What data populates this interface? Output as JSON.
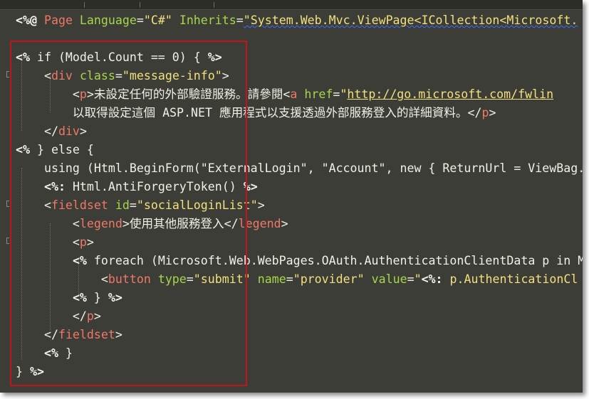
{
  "editor": {
    "lines": [
      {
        "segments": [
          {
            "t": "<%@ ",
            "c": "delim"
          },
          {
            "t": "Page ",
            "c": "tag"
          },
          {
            "t": "Language",
            "c": "attr"
          },
          {
            "t": "=",
            "c": "plain"
          },
          {
            "t": "\"C#\"",
            "c": "str"
          },
          {
            "t": " ",
            "c": "plain"
          },
          {
            "t": "Inherits",
            "c": "attr"
          },
          {
            "t": "=",
            "c": "plain"
          },
          {
            "t": "\"System.Web.Mvc.ViewPage<ICollection<Microsoft.",
            "c": "str squiggle"
          }
        ]
      },
      {
        "segments": []
      },
      {
        "segments": [
          {
            "t": "<%",
            "c": "delim"
          },
          {
            "t": " if (Model.Count == 0) { ",
            "c": "plain"
          },
          {
            "t": "%>",
            "c": "delim"
          }
        ]
      },
      {
        "segments": [
          {
            "t": "    <",
            "c": "plain"
          },
          {
            "t": "div",
            "c": "tag"
          },
          {
            "t": " ",
            "c": "plain"
          },
          {
            "t": "class",
            "c": "attr"
          },
          {
            "t": "=",
            "c": "plain"
          },
          {
            "t": "\"message-info\"",
            "c": "str"
          },
          {
            "t": ">",
            "c": "plain"
          }
        ]
      },
      {
        "segments": [
          {
            "t": "        <",
            "c": "plain"
          },
          {
            "t": "p",
            "c": "tag"
          },
          {
            "t": ">未設定任何的外部驗證服務。請參閱<",
            "c": "plain"
          },
          {
            "t": "a",
            "c": "tag"
          },
          {
            "t": " ",
            "c": "plain"
          },
          {
            "t": "href",
            "c": "attr"
          },
          {
            "t": "=",
            "c": "plain"
          },
          {
            "t": "\"",
            "c": "str"
          },
          {
            "t": "http://go.microsoft.com/fwlin",
            "c": "url"
          }
        ]
      },
      {
        "segments": [
          {
            "t": "        以取得設定這個 ASP.NET 應用程式以支援透過外部服務登入的詳細資料。</",
            "c": "plain"
          },
          {
            "t": "p",
            "c": "tag"
          },
          {
            "t": ">",
            "c": "plain"
          }
        ]
      },
      {
        "segments": [
          {
            "t": "    </",
            "c": "plain"
          },
          {
            "t": "div",
            "c": "tag"
          },
          {
            "t": ">",
            "c": "plain"
          }
        ]
      },
      {
        "segments": [
          {
            "t": "<%",
            "c": "delim"
          },
          {
            "t": " } else {",
            "c": "plain"
          }
        ]
      },
      {
        "segments": [
          {
            "t": "    using (Html.BeginForm(\"ExternalLogin\", \"Account\", new { ReturnUrl = ViewBag.",
            "c": "plain"
          }
        ]
      },
      {
        "segments": [
          {
            "t": "    ",
            "c": "plain"
          },
          {
            "t": "<%:",
            "c": "delim"
          },
          {
            "t": " Html.AntiForgeryToken() ",
            "c": "plain"
          },
          {
            "t": "%>",
            "c": "delim"
          }
        ]
      },
      {
        "segments": [
          {
            "t": "    <",
            "c": "plain"
          },
          {
            "t": "fieldset",
            "c": "tag"
          },
          {
            "t": " ",
            "c": "plain"
          },
          {
            "t": "id",
            "c": "attr"
          },
          {
            "t": "=",
            "c": "plain"
          },
          {
            "t": "\"socialLoginList\"",
            "c": "str"
          },
          {
            "t": ">",
            "c": "plain"
          }
        ]
      },
      {
        "segments": [
          {
            "t": "        <",
            "c": "plain"
          },
          {
            "t": "legend",
            "c": "tag"
          },
          {
            "t": ">使用其他服務登入</",
            "c": "plain"
          },
          {
            "t": "legend",
            "c": "tag"
          },
          {
            "t": ">",
            "c": "plain"
          }
        ]
      },
      {
        "segments": [
          {
            "t": "        <",
            "c": "plain"
          },
          {
            "t": "p",
            "c": "tag"
          },
          {
            "t": ">",
            "c": "plain"
          }
        ]
      },
      {
        "segments": [
          {
            "t": "        ",
            "c": "plain"
          },
          {
            "t": "<%",
            "c": "delim"
          },
          {
            "t": " foreach (Microsoft.Web.WebPages.OAuth.AuthenticationClientData p in M",
            "c": "plain"
          }
        ]
      },
      {
        "segments": [
          {
            "t": "            <",
            "c": "plain"
          },
          {
            "t": "button",
            "c": "tag"
          },
          {
            "t": " ",
            "c": "plain"
          },
          {
            "t": "type",
            "c": "attr"
          },
          {
            "t": "=",
            "c": "plain"
          },
          {
            "t": "\"submit\"",
            "c": "str"
          },
          {
            "t": " ",
            "c": "plain"
          },
          {
            "t": "name",
            "c": "attr"
          },
          {
            "t": "=",
            "c": "plain"
          },
          {
            "t": "\"provider\"",
            "c": "str"
          },
          {
            "t": " ",
            "c": "plain"
          },
          {
            "t": "value",
            "c": "attr"
          },
          {
            "t": "=",
            "c": "plain"
          },
          {
            "t": "\"",
            "c": "str"
          },
          {
            "t": "<%:",
            "c": "delim"
          },
          {
            "t": " p.AuthenticationCl",
            "c": "str"
          }
        ]
      },
      {
        "segments": [
          {
            "t": "        ",
            "c": "plain"
          },
          {
            "t": "<%",
            "c": "delim"
          },
          {
            "t": " } ",
            "c": "plain"
          },
          {
            "t": "%>",
            "c": "delim"
          }
        ]
      },
      {
        "segments": [
          {
            "t": "        </",
            "c": "plain"
          },
          {
            "t": "p",
            "c": "tag"
          },
          {
            "t": ">",
            "c": "plain"
          }
        ]
      },
      {
        "segments": [
          {
            "t": "    </",
            "c": "plain"
          },
          {
            "t": "fieldset",
            "c": "tag"
          },
          {
            "t": ">",
            "c": "plain"
          }
        ]
      },
      {
        "segments": [
          {
            "t": "    ",
            "c": "plain"
          },
          {
            "t": "<%",
            "c": "delim"
          },
          {
            "t": " }",
            "c": "plain"
          }
        ]
      },
      {
        "segments": [
          {
            "t": "} ",
            "c": "plain"
          },
          {
            "t": "%>",
            "c": "delim"
          }
        ]
      }
    ]
  },
  "colors": {
    "background": "#3b3d36",
    "tag": "#f07868",
    "attribute": "#a6d64b",
    "string": "#f2e07e",
    "text": "#f0f0e6",
    "highlight_box": "#c4141b"
  }
}
